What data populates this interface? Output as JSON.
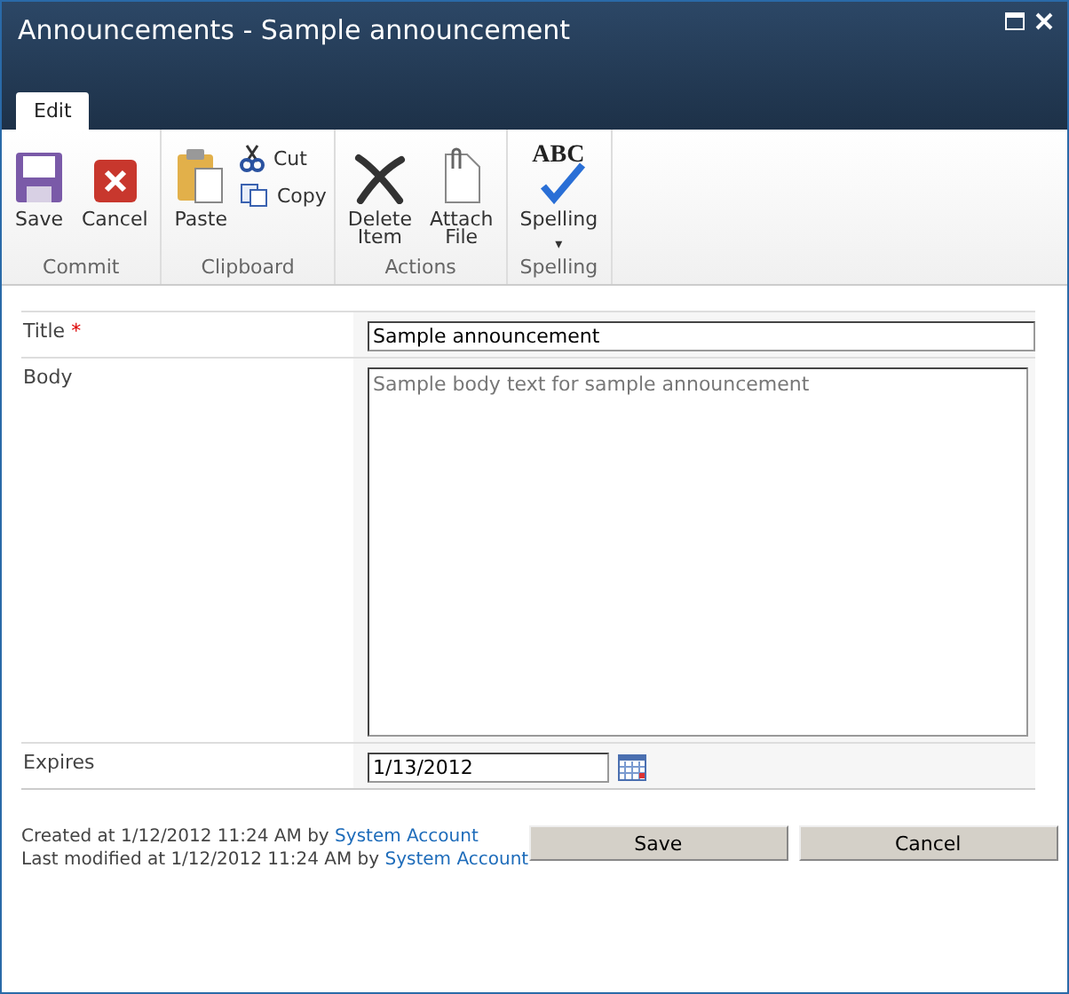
{
  "window": {
    "title": "Announcements - Sample announcement"
  },
  "tabs": [
    {
      "label": "Edit",
      "selected": true
    }
  ],
  "ribbon": [
    {
      "name": "Commit",
      "items": [
        {
          "label": "Save",
          "kind": "large"
        },
        {
          "label": "Cancel",
          "kind": "large"
        }
      ]
    },
    {
      "name": "Clipboard",
      "items": [
        {
          "label": "Paste",
          "kind": "large"
        },
        {
          "label": "Cut",
          "kind": "small"
        },
        {
          "label": "Copy",
          "kind": "small"
        }
      ]
    },
    {
      "name": "Actions",
      "items": [
        {
          "label": "Delete Item",
          "kind": "large"
        },
        {
          "label": "Attach File",
          "kind": "large"
        }
      ]
    },
    {
      "name": "Spelling",
      "items": [
        {
          "label": "Spelling",
          "kind": "dropdown",
          "icon_text": "ABC",
          "caret": "▾"
        }
      ]
    }
  ],
  "fields": [
    {
      "label": "Title",
      "required_mark": "*",
      "kind": "text",
      "value": "Sample announcement"
    },
    {
      "label": "Body",
      "kind": "multiline",
      "placeholder": "Sample body text for sample announcement"
    },
    {
      "label": "Expires",
      "kind": "date",
      "value": "1/13/2012"
    }
  ],
  "footer": {
    "created": {
      "text": "Created at 1/12/2012 11:24 AM by",
      "user": "System Account"
    },
    "modified": {
      "text": "Last modified at 1/12/2012 11:24 AM by",
      "user": "System Account"
    }
  },
  "buttons": [
    "Save",
    "Cancel"
  ]
}
